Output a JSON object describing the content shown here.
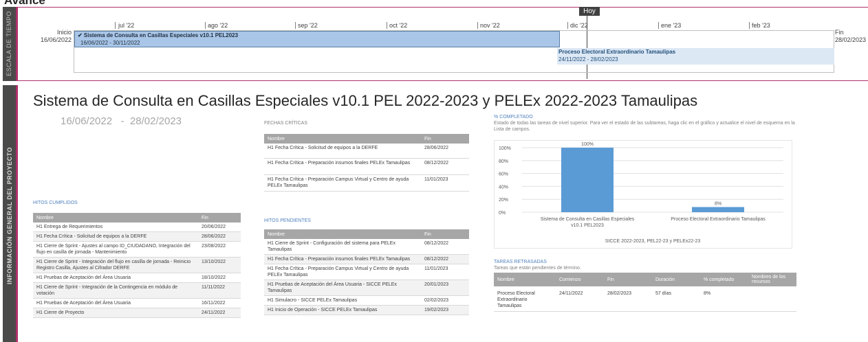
{
  "page": {
    "top_title": "Avance"
  },
  "timeline": {
    "side_label": "ESCALA DE TIEMPO",
    "today_label": "Hoy",
    "start": {
      "label": "Inicio",
      "date": "16/06/2022"
    },
    "end": {
      "label": "Fin",
      "date": "28/02/2023"
    },
    "months": [
      "jul '22",
      "ago '22",
      "sep '22",
      "oct '22",
      "nov '22",
      "dic '22",
      "ene '23",
      "feb '23"
    ],
    "bar1": {
      "title": "✔ Sistema de Consulta en Casillas Especiales v10.1 PEL2023",
      "dates": "16/06/2022 - 30/11/2022"
    },
    "bar2": {
      "title": "Proceso Electoral Extraordinario Tamaulipas",
      "dates": "24/11/2022 - 28/02/2023"
    }
  },
  "project": {
    "side_label": "INFORMACIÓN GENERAL DEL PROYECTO",
    "title": "Sistema de Consulta en Casillas Especiales v10.1 PEL 2022-2023 y PELEx 2022-2023 Tamaulipas",
    "start": "16/06/2022",
    "separator": "-",
    "end": "28/02/2023"
  },
  "fechas_criticas": {
    "label": "FECHAS CRÍTICAS",
    "headers": [
      "Nombre",
      "Fin"
    ],
    "rows": [
      [
        "H1 Fecha Crítica - Solicitud de equipos a la DERFE",
        "28/06/2022"
      ],
      [
        "H1 Fecha Crítica - Preparación insumos finales PELEx Tamaulipas",
        "08/12/2022"
      ],
      [
        "H1 Fecha Crítica - Preparación Campus Virtual y Centro de ayuda PELEx Tamaulipas",
        "11/01/2023"
      ]
    ]
  },
  "hitos_cumplidos": {
    "label": "HITOS CUMPLIDOS",
    "headers": [
      "Nombre",
      "Fin"
    ],
    "rows": [
      [
        "H1 Entrega de Requerimientos",
        "20/06/2022"
      ],
      [
        "H1 Fecha Crítica - Solicitud de equipos a la DERFE",
        "28/06/2022"
      ],
      [
        "H1 Cierre de Sprint - Ajustes al campo ID_CIUDADANO, Integración del flujo en casilla de jornada - Mantenimiento",
        "23/08/2022"
      ],
      [
        "H1 Cierre de Sprint - Integración del flujo en casilla de jornada - Reinicio Registro Casilla, Ajustes al Cifrador DERFE",
        "13/10/2022"
      ],
      [
        "H1 Pruebas de Aceptación del Área Usuaria",
        "18/10/2022"
      ],
      [
        "H1 Cierre de Sprint - Integración de la Contingencia en módulo de votación",
        "11/11/2022"
      ],
      [
        "H1 Pruebas de Aceptación del Área Usuaria",
        "16/11/2022"
      ],
      [
        "H1 Cierre de Proyecto",
        "24/11/2022"
      ]
    ]
  },
  "hitos_pendientes": {
    "label": "HITOS PENDIENTES",
    "headers": [
      "Nombre",
      "Fin"
    ],
    "rows": [
      [
        "H1 Cierre de Sprint - Configuración del sistema para PELEx Tamaulipas",
        "08/12/2022"
      ],
      [
        "H1 Fecha Crítica - Preparación insumos finales PELEx Tamaulipas",
        "08/12/2022"
      ],
      [
        "H1 Fecha Crítica - Preparación Campus Virtual y Centro de ayuda PELEx Tamaulipas",
        "11/01/2023"
      ],
      [
        "H1 Pruebas de Aceptación del Área Usuaria - SICCE PELEx Tamaulipas",
        "20/01/2023"
      ],
      [
        "H1 Simulacro - SICCE PELEx Tamaulipas",
        "02/02/2023"
      ],
      [
        "H1 Inicio de Operación - SICCE PELEx Tamaulipas",
        "19/02/2023"
      ]
    ]
  },
  "completado": {
    "label": "% COMPLETADO",
    "description": "Estado de todas las tareas de nivel superior. Para ver el estado de las subtareas, haga clic en el gráfico y actualice el nivel de esquema en la Lista de campos."
  },
  "chart_data": {
    "type": "bar",
    "categories": [
      "Sistema de Consulta en Casillas Especiales v10.1 PEL2023",
      "Proceso Electoral Extraordinario Tamaulipas"
    ],
    "values": [
      100,
      8
    ],
    "value_labels": [
      "100%",
      "8%"
    ],
    "xlabel": "SICCE 2022-2023, PEL22-23 y PELEx22-23",
    "ylim": [
      0,
      100
    ],
    "yticks": [
      "0%",
      "20%",
      "40%",
      "60%",
      "80%",
      "100%"
    ],
    "grid": true,
    "bar_color": "#5b9bd5"
  },
  "tareas_retrasadas": {
    "label": "TAREAS RETRASADAS",
    "description": "Tareas que están pendientes de término.",
    "headers": [
      "Nombre",
      "Comienzo",
      "Fin",
      "Duración",
      "% completado",
      "Nombres de los recursos"
    ],
    "rows": [
      [
        "Proceso Electoral Extraordinario Tamaulipas",
        "24/11/2022",
        "28/02/2023",
        "57 días",
        "8%",
        ""
      ]
    ]
  },
  "colors": {
    "accent": "#b0306a",
    "sidebar": "#4a4a4a",
    "link": "#4f81bd"
  }
}
